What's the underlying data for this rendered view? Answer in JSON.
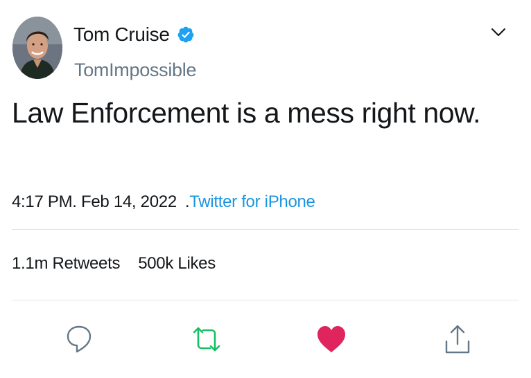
{
  "tweet": {
    "author": {
      "display_name": "Tom Cruise",
      "handle": "TomImpossible",
      "verified_icon": "verified-badge-icon",
      "avatar_icon": "profile-photo"
    },
    "text": "Law Enforcement is a mess right now.",
    "time": "4:17 PM. Feb 14, 2022",
    "source_separator": ".",
    "source": "Twitter for iPhone",
    "stats": {
      "retweets_count": "1.1m",
      "retweets_label": "Retweets",
      "likes_count": "500k",
      "likes_label": "Likes"
    },
    "actions": [
      "reply-icon",
      "retweet-icon",
      "like-icon",
      "share-icon"
    ]
  },
  "colors": {
    "text": "#14171a",
    "muted": "#657786",
    "link": "#1b95e0",
    "verified": "#1da1f2",
    "retweet": "#17bf63",
    "like": "#e0245e",
    "divider": "#e1e8ed"
  }
}
